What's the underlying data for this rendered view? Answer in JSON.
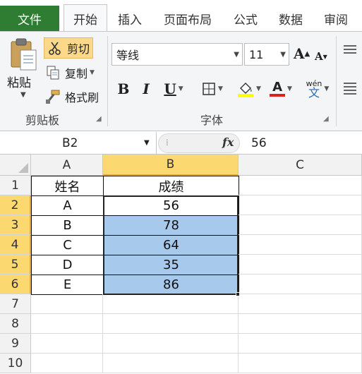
{
  "tabs": {
    "file": "文件",
    "items": [
      "开始",
      "插入",
      "页面布局",
      "公式",
      "数据",
      "审阅"
    ]
  },
  "clipboard": {
    "paste": "粘贴",
    "cut": "剪切",
    "copy": "复制",
    "format_painter": "格式刷",
    "group_label": "剪贴板"
  },
  "font": {
    "name": "等线",
    "size": "11",
    "group_label": "字体",
    "bold": "B",
    "italic": "I",
    "underline": "U",
    "grow": "A",
    "shrink": "A",
    "font_color": "A",
    "phonetic": "wén"
  },
  "formula_bar": {
    "name_box": "B2",
    "fx": "fx",
    "value": "56"
  },
  "sheet": {
    "columns": [
      "A",
      "B",
      "C"
    ],
    "rows": [
      "1",
      "2",
      "3",
      "4",
      "5",
      "6",
      "7",
      "8",
      "9",
      "10"
    ],
    "header": {
      "a": "姓名",
      "b": "成绩"
    },
    "data": [
      {
        "a": "A",
        "b": "56"
      },
      {
        "a": "B",
        "b": "78"
      },
      {
        "a": "C",
        "b": "64"
      },
      {
        "a": "D",
        "b": "35"
      },
      {
        "a": "E",
        "b": "86"
      }
    ]
  },
  "colors": {
    "file_tab": "#2e7d32",
    "selection_fill": "#a6c9ec",
    "selected_header": "#fbd970",
    "cut_highlight": "#fcd98a"
  }
}
